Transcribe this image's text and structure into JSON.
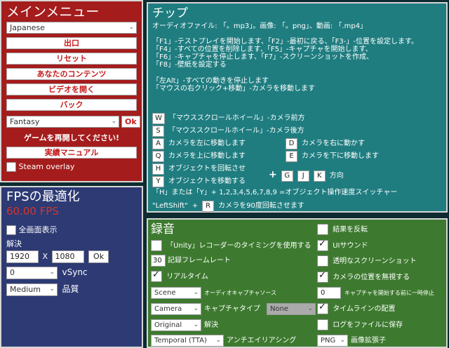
{
  "main_menu": {
    "title": "メインメニュー",
    "language": "Japanese",
    "buttons": {
      "exit": "出口",
      "reset": "リセット",
      "your_content": "あなたのコンテンツ",
      "open_video": "ビデオを開く",
      "back": "バック"
    },
    "environment": "Fantasy",
    "ok": "Ok",
    "restart_warning": "ゲームを再開してください!",
    "manual": "実績マニュアル",
    "steam_overlay": "Steam overlay"
  },
  "tips": {
    "title": "チップ",
    "file_types": "オーディオファイル: 「。mp3」。画像: 「。png」、動画: 「.mp4」",
    "lines": [
      "「F1」-テストプレイを開始します、「F2」-最初に戻る、「F3-」-位置を設定します。",
      "「F4」-すべての位置を削除します、「F5」-キャプチャを開始します、",
      "「F6」-キャプチャを停止します、「F7」-スクリーンショットを作成、",
      "「F8」-壁紙を設定する"
    ],
    "alt_line": "「左Alt」-すべての動きを停止します",
    "rmb_line": "「マウスの右クリック+移動」-カメラを移動します",
    "keys": {
      "w": {
        "key": "W",
        "text": "「マウススクロールホイール」-カメラ前方"
      },
      "s": {
        "key": "S",
        "text": "「マウススクロールホイール」-カメラ後方"
      },
      "a": {
        "key": "A",
        "text": "カメラを左に移動します"
      },
      "d": {
        "key": "D",
        "text": "カメラを右に動かす"
      },
      "q": {
        "key": "Q",
        "text": "カメラを上に移動します"
      },
      "e": {
        "key": "E",
        "text": "カメラを下に移動します"
      },
      "h": {
        "key": "H",
        "text": "オブジェクトを回転させ"
      },
      "y": {
        "key": "Y",
        "text": "オブジェクトを移動する"
      }
    },
    "plus": "+",
    "direction_keys": [
      "G",
      "J",
      "K"
    ],
    "direction_label": "方向",
    "speed_line": "「H」または「Y」+ 1,2,3,4,5,6,7,8,9 =オブジェクト操作速度スイッチャー",
    "leftshift": "\"LeftShift\"",
    "r_key": "R",
    "rotate_text": "カメラを90度回転させます"
  },
  "fps": {
    "title": "FPSの最適化",
    "value": "60.00 FPS",
    "fullscreen": "全画面表示",
    "resolution_label": "解決",
    "width": "1920",
    "x": "X",
    "height": "1080",
    "ok": "Ok",
    "vsync_value": "0",
    "vsync_label": "vSync",
    "quality_value": "Medium",
    "quality_label": "品質"
  },
  "recording": {
    "title": "録音",
    "unity_timing": "「Unity」レコーダーのタイミングを使用する",
    "framerate_value": "30",
    "framerate_label": "記録フレームレート",
    "realtime": "リアルタイム",
    "audio_source_value": "Scene",
    "audio_source_label": "オーディオキャプチャソース",
    "capture_type_value": "Camera",
    "capture_type_label": "キャプチャタイプ",
    "capture_none": "None",
    "resolution_value": "Original",
    "resolution_label": "解決",
    "aa_value": "Temporal (TTA)",
    "aa_label": "アンチエイリアシング",
    "invert": "結果を反転",
    "ui_sound": "UIサウンド",
    "transparent_screenshot": "透明なスクリーンショット",
    "ignore_camera": "カメラの位置を無視する",
    "pause_value": "0",
    "pause_label": "キャプチャを開始する前に一時停止",
    "timeline": "タイムラインの配置",
    "log_file": "ログをファイルに保存",
    "ext_value": "PNG",
    "ext_label": "画像拡張子"
  }
}
